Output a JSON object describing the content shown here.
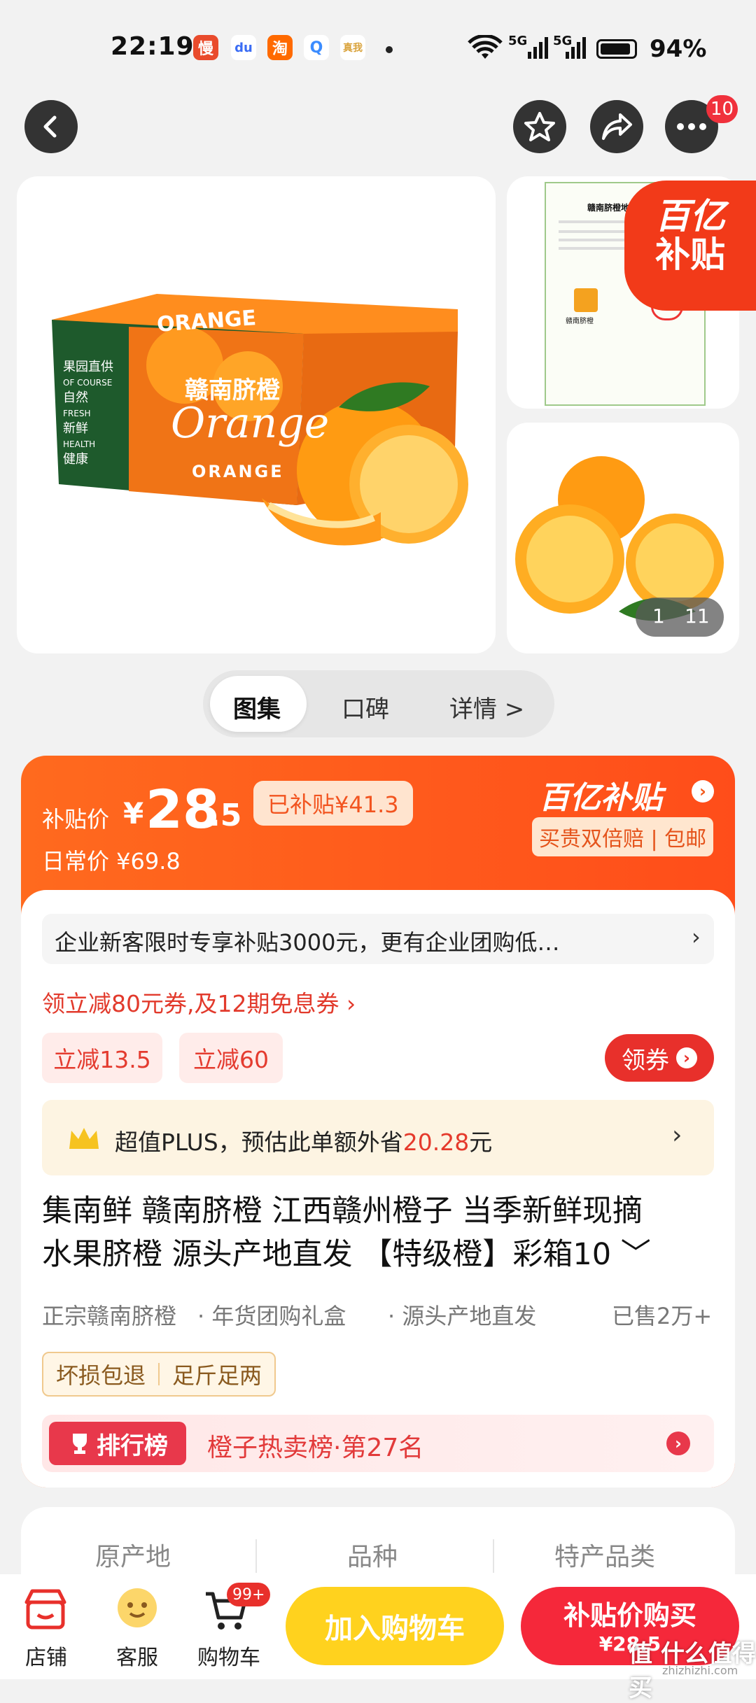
{
  "status_bar": {
    "time": "22:19",
    "apps": [
      {
        "glyph": "慢",
        "color": "#e94b2c"
      },
      {
        "glyph": "du",
        "color": "#3a6cf4"
      },
      {
        "glyph": "淘",
        "color": "#ff6a00"
      },
      {
        "glyph": "Q",
        "color": "#3b8cff"
      },
      {
        "glyph": "真我",
        "color": "#d9a23a"
      }
    ],
    "signal_1": "5G",
    "signal_2": "5G",
    "battery": "94%"
  },
  "header": {
    "more_badge": "10"
  },
  "gallery": {
    "main_box_texts": {
      "orange_title": "ORANGE",
      "chinese_name": "赣南脐橙",
      "script": "Orange",
      "sub": "ORANGE",
      "side_1": "果园直供",
      "side_2": "OF COURSE",
      "side_3": "自然",
      "side_4": "FRESH",
      "side_5": "新鲜",
      "side_6": "HEALTH",
      "side_7": "健康"
    },
    "certificate_title": "赣南脐橙地理标志证",
    "certificate_logo": "赣南脐橙",
    "brand_badge_top": "百亿",
    "brand_badge_bottom": "补贴",
    "page_current": "1",
    "page_total": "11"
  },
  "tabs": [
    {
      "label": "图集",
      "active": true
    },
    {
      "label": "口碑",
      "active": false
    },
    {
      "label": "详情 >",
      "active": false
    }
  ],
  "price": {
    "subsidy_label": "补贴价",
    "currency": "¥",
    "integer": "28",
    "decimal": ".5",
    "subsidized": "已补贴¥41.3",
    "daily_label": "日常价 ¥69.8",
    "brand": "百亿补贴",
    "guarantee": "买贵双倍赔 | 包邮"
  },
  "promo": {
    "enterprise": "企业新客限时专享补贴3000元，更有企业团购低…",
    "coupon_line": "领立减80元券,及12期免息券 ›",
    "tag_1": "立减13.5",
    "tag_2": "立减60",
    "get_coupon": "领券",
    "plus_prefix": "超值PLUS，预估此单额外省",
    "plus_amount": "20.28",
    "plus_suffix": "元"
  },
  "product": {
    "title_line_1": "集南鲜 赣南脐橙 江西赣州橙子 当季新鲜现摘",
    "title_line_2": "水果脐橙 源头产地直发 【特级橙】彩箱10 ﹀",
    "feature_1": "正宗赣南脐橙",
    "feature_2": "· 年货团购礼盒",
    "feature_3": "· 源头产地直发",
    "sold": "已售2万+",
    "service_1": "坏损包退",
    "service_2": "足斤足两",
    "rank_label": "排行榜",
    "rank_text": "橙子热卖榜·第27名"
  },
  "specs": {
    "col_1": "原产地",
    "col_2": "品种",
    "col_3": "特产品类"
  },
  "bottom_bar": {
    "store": "店铺",
    "service": "客服",
    "cart": "购物车",
    "cart_badge": "99+",
    "add_to_cart": "加入购物车",
    "buy_now": "补贴价购买",
    "buy_price": "¥28.5",
    "watermark": "值 什么值得买",
    "watermark_url": "zhizhizhi.com"
  },
  "colors": {
    "accent": "#ff4d1a",
    "yellow_button": "#ffd21e",
    "red_button": "#f5283a"
  }
}
